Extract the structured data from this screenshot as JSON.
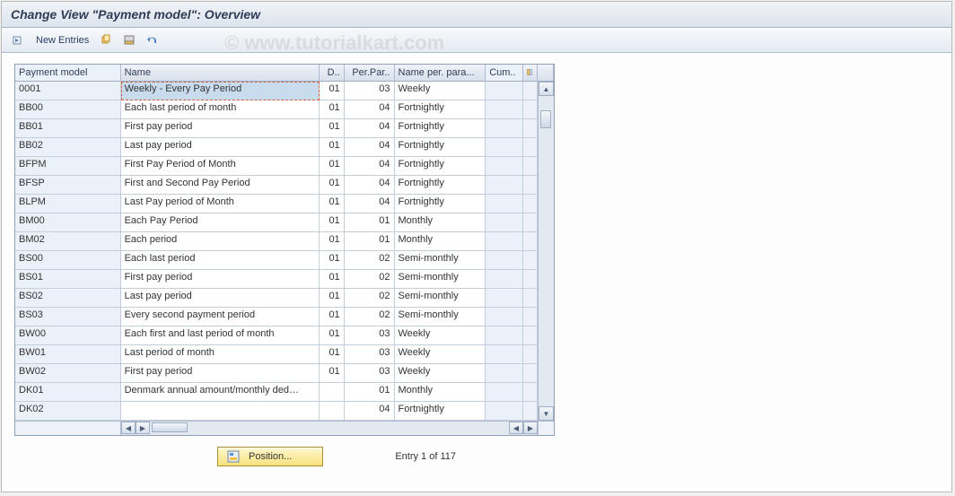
{
  "title": "Change View \"Payment model\": Overview",
  "watermark": "© www.tutorialkart.com",
  "toolbar": {
    "new_entries": "New Entries"
  },
  "columns": {
    "pm": "Payment model",
    "name": "Name",
    "d": "D..",
    "pp": "Per.Par..",
    "np": "Name per. para...",
    "cum": "Cum.."
  },
  "rows": [
    {
      "pm": "0001",
      "name": "Weekly - Every Pay Period",
      "d": "01",
      "pp": "03",
      "np": "Weekly",
      "cum": ""
    },
    {
      "pm": "BB00",
      "name": "Each last period of month",
      "d": "01",
      "pp": "04",
      "np": "Fortnightly",
      "cum": ""
    },
    {
      "pm": "BB01",
      "name": "First pay period",
      "d": "01",
      "pp": "04",
      "np": "Fortnightly",
      "cum": ""
    },
    {
      "pm": "BB02",
      "name": "Last pay period",
      "d": "01",
      "pp": "04",
      "np": "Fortnightly",
      "cum": ""
    },
    {
      "pm": "BFPM",
      "name": "First Pay Period of Month",
      "d": "01",
      "pp": "04",
      "np": "Fortnightly",
      "cum": ""
    },
    {
      "pm": "BFSP",
      "name": "First and Second Pay Period",
      "d": "01",
      "pp": "04",
      "np": "Fortnightly",
      "cum": ""
    },
    {
      "pm": "BLPM",
      "name": "Last Pay period of Month",
      "d": "01",
      "pp": "04",
      "np": "Fortnightly",
      "cum": ""
    },
    {
      "pm": "BM00",
      "name": "Each Pay Period",
      "d": "01",
      "pp": "01",
      "np": "Monthly",
      "cum": ""
    },
    {
      "pm": "BM02",
      "name": "Each period",
      "d": "01",
      "pp": "01",
      "np": "Monthly",
      "cum": ""
    },
    {
      "pm": "BS00",
      "name": "Each last period",
      "d": "01",
      "pp": "02",
      "np": "Semi-monthly",
      "cum": ""
    },
    {
      "pm": "BS01",
      "name": "First pay period",
      "d": "01",
      "pp": "02",
      "np": "Semi-monthly",
      "cum": ""
    },
    {
      "pm": "BS02",
      "name": "Last pay period",
      "d": "01",
      "pp": "02",
      "np": "Semi-monthly",
      "cum": ""
    },
    {
      "pm": "BS03",
      "name": "Every second payment period",
      "d": "01",
      "pp": "02",
      "np": "Semi-monthly",
      "cum": ""
    },
    {
      "pm": "BW00",
      "name": "Each first and last period of month",
      "d": "01",
      "pp": "03",
      "np": "Weekly",
      "cum": ""
    },
    {
      "pm": "BW01",
      "name": "Last period of month",
      "d": "01",
      "pp": "03",
      "np": "Weekly",
      "cum": ""
    },
    {
      "pm": "BW02",
      "name": "First pay period",
      "d": "01",
      "pp": "03",
      "np": "Weekly",
      "cum": ""
    },
    {
      "pm": "DK01",
      "name": "Denmark annual amount/monthly ded…",
      "d": "",
      "pp": "01",
      "np": "Monthly",
      "cum": ""
    },
    {
      "pm": "DK02",
      "name": "",
      "d": "",
      "pp": "04",
      "np": "Fortnightly",
      "cum": ""
    }
  ],
  "footer": {
    "position": "Position...",
    "status": "Entry 1 of 117"
  }
}
